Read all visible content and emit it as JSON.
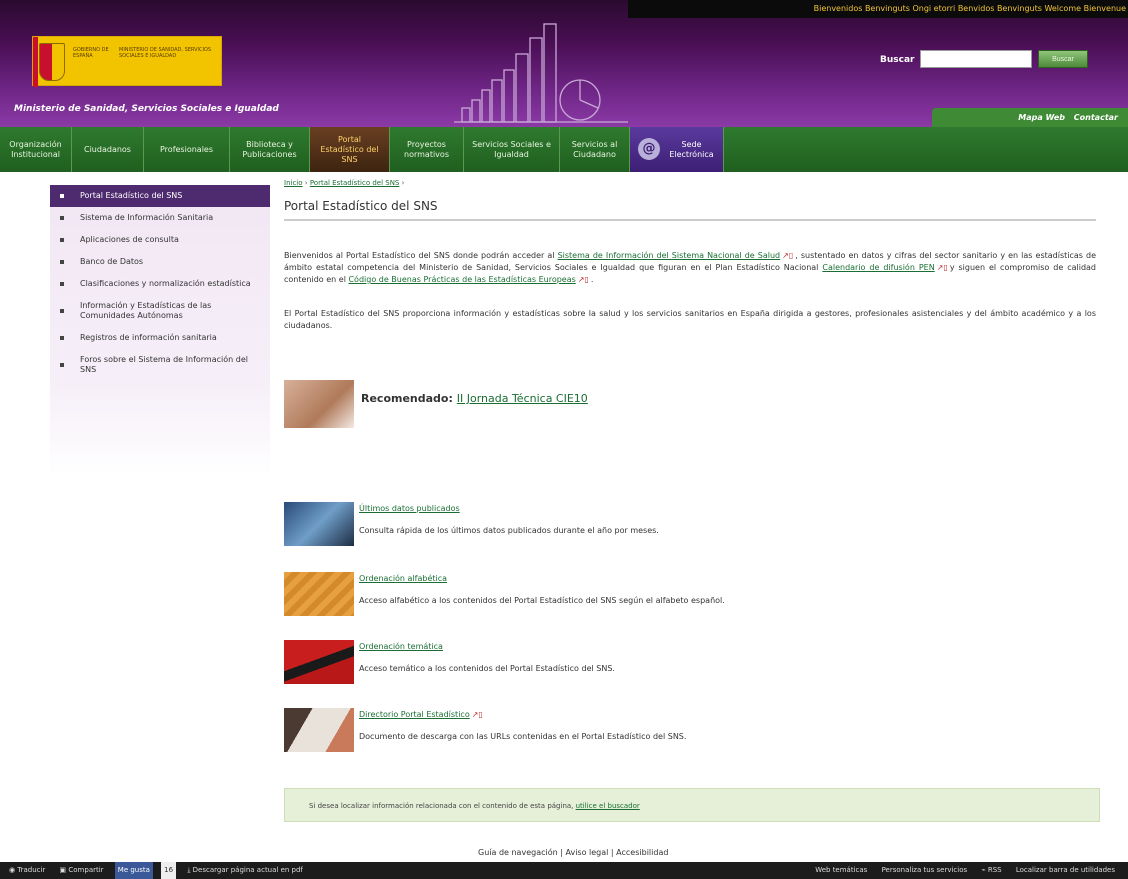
{
  "lang_bar": "Bienvenidos Benvinguts Ongi etorri Benvidos Benvinguts Welcome Bienvenue",
  "logo": {
    "gov_text": "GOBIERNO DE ESPAÑA",
    "ministry_text": "MINISTERIO DE SANIDAD, SERVICIOS SOCIALES E IGUALDAD"
  },
  "header": {
    "ministry_name": "Ministerio de Sanidad, Servicios Sociales e Igualdad",
    "search_label": "Buscar",
    "search_value": "",
    "search_button": "Buscar",
    "right_links": [
      "Mapa Web",
      "Contactar"
    ]
  },
  "nav": [
    "Organización Institucional",
    "Ciudadanos",
    "Profesionales",
    "Biblioteca y Publicaciones",
    "Portal Estadístico del SNS",
    "Proyectos normativos",
    "Servicios Sociales e Igualdad",
    "Servicios al Ciudadano",
    "Sede Electrónica"
  ],
  "sidebar": [
    "Portal Estadístico del SNS",
    "Sistema de Información Sanitaria",
    "Aplicaciones de consulta",
    "Banco de Datos",
    "Clasificaciones y normalización estadística",
    "Información y Estadísticas de las Comunidades Autónomas",
    "Registros de información sanitaria",
    "Foros sobre el Sistema de Información del SNS"
  ],
  "breadcrumb": {
    "home": "Inicio",
    "sep": "›",
    "current": "Portal Estadístico del SNS"
  },
  "page_title": "Portal Estadístico del SNS",
  "intro": {
    "p1_a": "Bienvenidos al Portal Estadístico del SNS donde podrán acceder al",
    "link1": "Sistema de Información del Sistema Nacional de Salud",
    "p1_b": ", sustentado en datos y cifras del sector sanitario y en las estadísticas de ámbito estatal competencia del Ministerio de Sanidad, Servicios Sociales e Igualdad que figuran en el Plan Estadístico Nacional",
    "link2": "Calendario de difusión PEN",
    "p1_c": "y siguen el compromiso de calidad contenido en el",
    "link3": "Código de Buenas Prácticas de las Estadísticas Europeas",
    "p2": "El Portal Estadístico del SNS proporciona información y estadísticas sobre la salud y los servicios sanitarios en España dirigida a gestores, profesionales asistenciales y del ámbito académico y a los ciudadanos."
  },
  "recommended": {
    "label": "Recomendado:",
    "link": "II Jornada Técnica CIE10"
  },
  "features": [
    {
      "title": "Últimos datos publicados",
      "desc": "Consulta rápida de los últimos datos publicados durante el año por meses."
    },
    {
      "title": "Ordenación alfabética",
      "desc": "Acceso alfabético a los contenidos del Portal Estadístico del SNS según el alfabeto español."
    },
    {
      "title": "Ordenación temática",
      "desc": "Acceso temático a los contenidos del Portal Estadístico del SNS."
    },
    {
      "title": "Directorio Portal Estadístico",
      "desc": "Documento de descarga con las URLs contenidas en el Portal Estadístico del SNS."
    }
  ],
  "search_note": {
    "text": "Si desea localizar información relacionada con el contenido de esta página,",
    "link": "utilice el buscador"
  },
  "footer_links": [
    "Guía de navegación",
    "Aviso legal",
    "Accesibilidad"
  ],
  "bottom_bar": {
    "left": [
      "Traducir",
      "Compartir",
      "Me gusta",
      "16",
      "Descargar página actual en pdf"
    ],
    "right": [
      "Web temáticas",
      "Personaliza tus servicios",
      "RSS",
      "Localizar barra de utilidades"
    ]
  }
}
